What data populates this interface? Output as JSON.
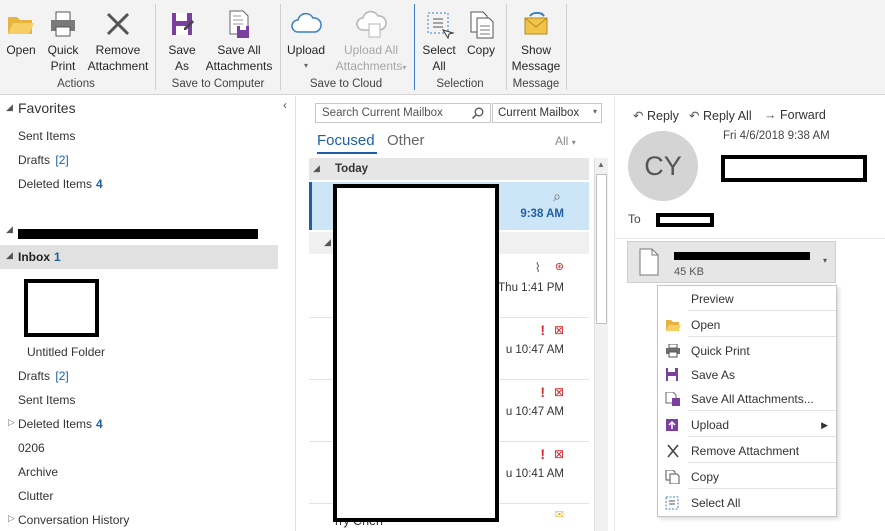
{
  "ribbon": {
    "open": "Open",
    "quick_print": [
      "Quick",
      "Print"
    ],
    "remove_attachment": [
      "Remove",
      "Attachment"
    ],
    "group_actions": "Actions",
    "save_as": [
      "Save",
      "As"
    ],
    "save_all": [
      "Save All",
      "Attachments"
    ],
    "group_save_computer": "Save to Computer",
    "upload": "Upload",
    "upload_all": [
      "Upload All",
      "Attachments"
    ],
    "group_save_cloud": "Save to Cloud",
    "select_all": [
      "Select",
      "All"
    ],
    "copy": "Copy",
    "group_selection": "Selection",
    "show_message": [
      "Show",
      "Message"
    ],
    "group_message": "Message"
  },
  "folders": {
    "favorites_header": "Favorites",
    "fav_sent": "Sent Items",
    "fav_drafts": "Drafts",
    "fav_drafts_count": "[2]",
    "fav_deleted": "Deleted Items",
    "fav_deleted_count": "4",
    "inbox": "Inbox",
    "inbox_count": "1",
    "untitled": "Untitled Folder",
    "drafts": "Drafts",
    "drafts_count": "[2]",
    "sent": "Sent Items",
    "deleted": "Deleted Items",
    "deleted_count": "4",
    "f0206": "0206",
    "archive": "Archive",
    "clutter": "Clutter",
    "conv_history": "Conversation History"
  },
  "list": {
    "search_placeholder": "Search Current Mailbox",
    "scope": "Current Mailbox",
    "tab_focused": "Focused",
    "tab_other": "Other",
    "filter": "All",
    "group_today": "Today",
    "times": [
      "9:38 AM",
      "Thu 1:41 PM",
      "u 10:47 AM",
      "u 10:47 AM",
      "u 10:41 AM"
    ],
    "last_sender": "rry Chen"
  },
  "reading": {
    "reply": "Reply",
    "reply_all": "Reply All",
    "forward": "Forward",
    "date": "Fri 4/6/2018 9:38 AM",
    "avatar": "CY",
    "to_label": "To",
    "attachment_size": "45 KB"
  },
  "menu": {
    "preview": "Preview",
    "open": "Open",
    "quick_print": "Quick Print",
    "save_as": "Save As",
    "save_all": "Save All Attachments...",
    "upload": "Upload",
    "remove": "Remove Attachment",
    "copy": "Copy",
    "select_all": "Select All"
  },
  "colors": {
    "accent": "#1e5fa7",
    "ribbon_bg": "#f3f3f3",
    "selected_bg": "#cde6f7",
    "flag_red": "#d9272e"
  }
}
